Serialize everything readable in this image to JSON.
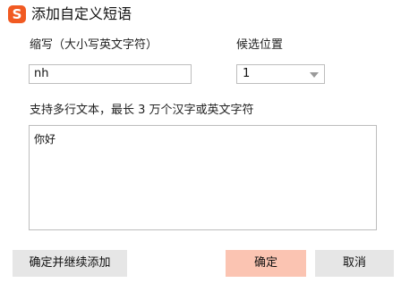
{
  "window": {
    "logo_char": "S",
    "title": "添加自定义短语"
  },
  "form": {
    "abbr_label": "缩写（大小写英文字符）",
    "abbr_value": "nh",
    "position_label": "候选位置",
    "position_value": "1",
    "text_label": "支持多行文本，最长 3 万个汉字或英文字符",
    "text_value": "你好"
  },
  "buttons": {
    "confirm_continue": "确定并继续添加",
    "confirm": "确定",
    "cancel": "取消"
  },
  "colors": {
    "logo": "#f15a22",
    "primary_button": "#fbc4b2",
    "secondary_button": "#e6e6e6",
    "border": "#bdbdbd"
  },
  "icons": {
    "logo": "sogou-logo-icon",
    "dropdown": "chevron-down-icon"
  }
}
